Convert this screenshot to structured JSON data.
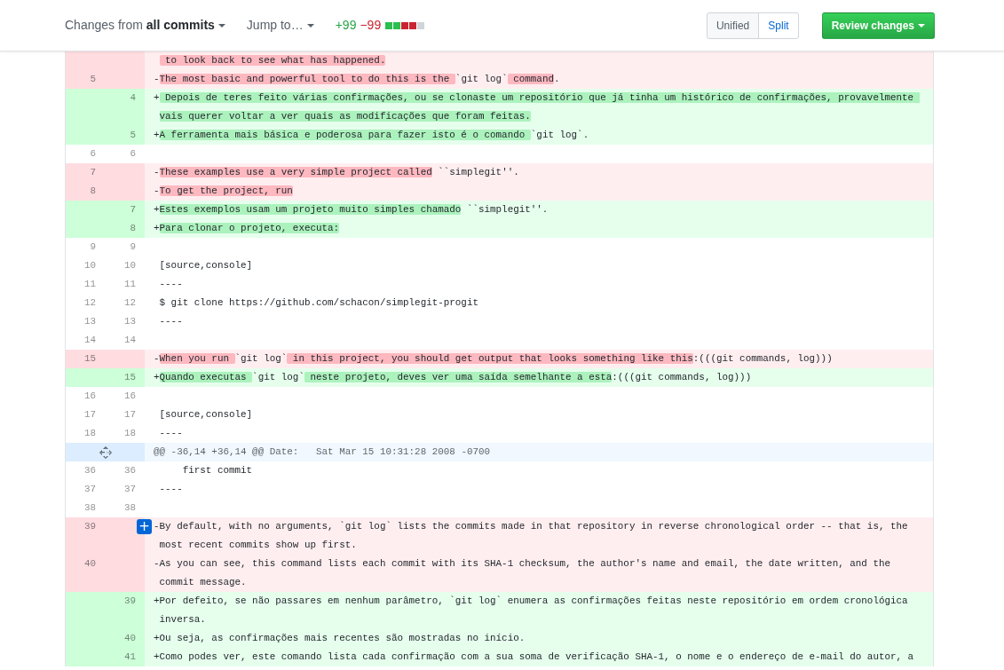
{
  "toolbar": {
    "changes_menu": "Changes from **all commits**",
    "jump_menu": "Jump to…",
    "additions": "+99",
    "deletions": "−99",
    "diffstat": [
      {
        "color": "#2cbe4e"
      },
      {
        "color": "#2cbe4e"
      },
      {
        "color": "#cb2431"
      },
      {
        "color": "#cb2431"
      },
      {
        "color": "#d1d5da"
      }
    ],
    "view_modes": [
      {
        "label": "Unified",
        "selected": true
      },
      {
        "label": "Split",
        "selected": false
      }
    ],
    "review_button": "Review changes"
  },
  "diff": {
    "lines": [
      {
        "kind": "deletion",
        "segments": [
          {
            "text": " to look back to see what has happened.",
            "highlight": true
          }
        ]
      },
      {
        "kind": "deletion",
        "old_number": "5",
        "marker": "-",
        "segments": [
          {
            "text": "The most basic and powerful tool to do this is the ",
            "highlight": true
          },
          {
            "text": "`git log`",
            "highlight": false
          },
          {
            "text": " command",
            "highlight": true
          },
          {
            "text": ".",
            "highlight": false
          }
        ]
      },
      {
        "kind": "addition",
        "new_number": "4",
        "marker": "+",
        "segments": [
          {
            "text": " Depois de teres feito várias confirmações, ou se clonaste um repositório que já tinha um histórico de confirmações, provavelmente vais querer voltar a ver quais as modificações que foram feitas.",
            "highlight": true
          }
        ]
      },
      {
        "kind": "addition",
        "new_number": "5",
        "marker": "+",
        "segments": [
          {
            "text": "A ferramenta mais básica e poderosa para fazer isto é o comando ",
            "highlight": true
          },
          {
            "text": "`git log`.",
            "highlight": false
          }
        ]
      },
      {
        "kind": "context",
        "old_number": "6",
        "new_number": "6"
      },
      {
        "kind": "deletion",
        "old_number": "7",
        "marker": "-",
        "segments": [
          {
            "text": "These examples use a very simple project called",
            "highlight": true
          },
          {
            "text": " ``simplegit''.",
            "highlight": false
          }
        ]
      },
      {
        "kind": "deletion",
        "old_number": "8",
        "marker": "-",
        "segments": [
          {
            "text": "To get the project, run",
            "highlight": true
          }
        ]
      },
      {
        "kind": "addition",
        "new_number": "7",
        "marker": "+",
        "segments": [
          {
            "text": "Estes exemplos usam um projeto muito simples chamado",
            "highlight": true
          },
          {
            "text": " ``simplegit''.",
            "highlight": false
          }
        ]
      },
      {
        "kind": "addition",
        "new_number": "8",
        "marker": "+",
        "segments": [
          {
            "text": "Para clonar o projeto, executa:",
            "highlight": true
          }
        ]
      },
      {
        "kind": "context",
        "old_number": "9",
        "new_number": "9"
      },
      {
        "kind": "context",
        "old_number": "10",
        "new_number": "10",
        "segments": [
          {
            "text": "[source,console]"
          }
        ]
      },
      {
        "kind": "context",
        "old_number": "11",
        "new_number": "11",
        "segments": [
          {
            "text": "----"
          }
        ]
      },
      {
        "kind": "context",
        "old_number": "12",
        "new_number": "12",
        "segments": [
          {
            "text": "$ git clone https://github.com/schacon/simplegit-progit"
          }
        ]
      },
      {
        "kind": "context",
        "old_number": "13",
        "new_number": "13",
        "segments": [
          {
            "text": "----"
          }
        ]
      },
      {
        "kind": "context",
        "old_number": "14",
        "new_number": "14"
      },
      {
        "kind": "deletion",
        "old_number": "15",
        "marker": "-",
        "segments": [
          {
            "text": "When you run ",
            "highlight": true
          },
          {
            "text": "`git log`",
            "highlight": false
          },
          {
            "text": " in this project, you should get output that looks something like this",
            "highlight": true
          },
          {
            "text": ":(((git commands, log)))",
            "highlight": false
          }
        ]
      },
      {
        "kind": "addition",
        "new_number": "15",
        "marker": "+",
        "segments": [
          {
            "text": "Quando executas ",
            "highlight": true
          },
          {
            "text": "`git log`",
            "highlight": false
          },
          {
            "text": " neste projeto, deves ver uma saída semelhante a esta",
            "highlight": true
          },
          {
            "text": ":(((git commands, log)))",
            "highlight": false
          }
        ]
      },
      {
        "kind": "context",
        "old_number": "16",
        "new_number": "16"
      },
      {
        "kind": "context",
        "old_number": "17",
        "new_number": "17",
        "segments": [
          {
            "text": "[source,console]"
          }
        ]
      },
      {
        "kind": "context",
        "old_number": "18",
        "new_number": "18",
        "segments": [
          {
            "text": "----"
          }
        ]
      },
      {
        "kind": "hunk",
        "segments": [
          {
            "text": "@@ -36,14 +36,14 @@ Date:   Sat Mar 15 10:31:28 2008 -0700"
          }
        ]
      },
      {
        "kind": "context",
        "old_number": "36",
        "new_number": "36",
        "segments": [
          {
            "text": "    first commit"
          }
        ]
      },
      {
        "kind": "context",
        "old_number": "37",
        "new_number": "37",
        "segments": [
          {
            "text": "----"
          }
        ]
      },
      {
        "kind": "context",
        "old_number": "38",
        "new_number": "38"
      },
      {
        "kind": "deletion",
        "old_number": "39",
        "marker": "-",
        "comment_button": "+",
        "segments": [
          {
            "text": "By default, with no arguments, `git log` lists the commits made in that repository in reverse chronological order -- that is, the most recent commits show up first.",
            "highlight": false
          }
        ]
      },
      {
        "kind": "deletion",
        "old_number": "40",
        "marker": "-",
        "segments": [
          {
            "text": "As you can see, this command lists each commit with its SHA-1 checksum, the author's name and email, the date written, and the commit message.",
            "highlight": false
          }
        ]
      },
      {
        "kind": "addition",
        "new_number": "39",
        "marker": "+",
        "segments": [
          {
            "text": "Por defeito, se não passares em nenhum parâmetro, `git log` enumera as confirmações feitas neste repositório em ordem cronológica inversa.",
            "highlight": false
          }
        ]
      },
      {
        "kind": "addition",
        "new_number": "40",
        "marker": "+",
        "segments": [
          {
            "text": "Ou seja, as confirmações mais recentes são mostradas no início.",
            "highlight": false
          }
        ]
      },
      {
        "kind": "addition",
        "new_number": "41",
        "marker": "+",
        "segments": [
          {
            "text": "Como podes ver, este comando lista cada confirmação com a sua soma de verificação SHA-1, o nome e o endereço de e-mail do autor, a",
            "highlight": false
          }
        ]
      }
    ]
  }
}
